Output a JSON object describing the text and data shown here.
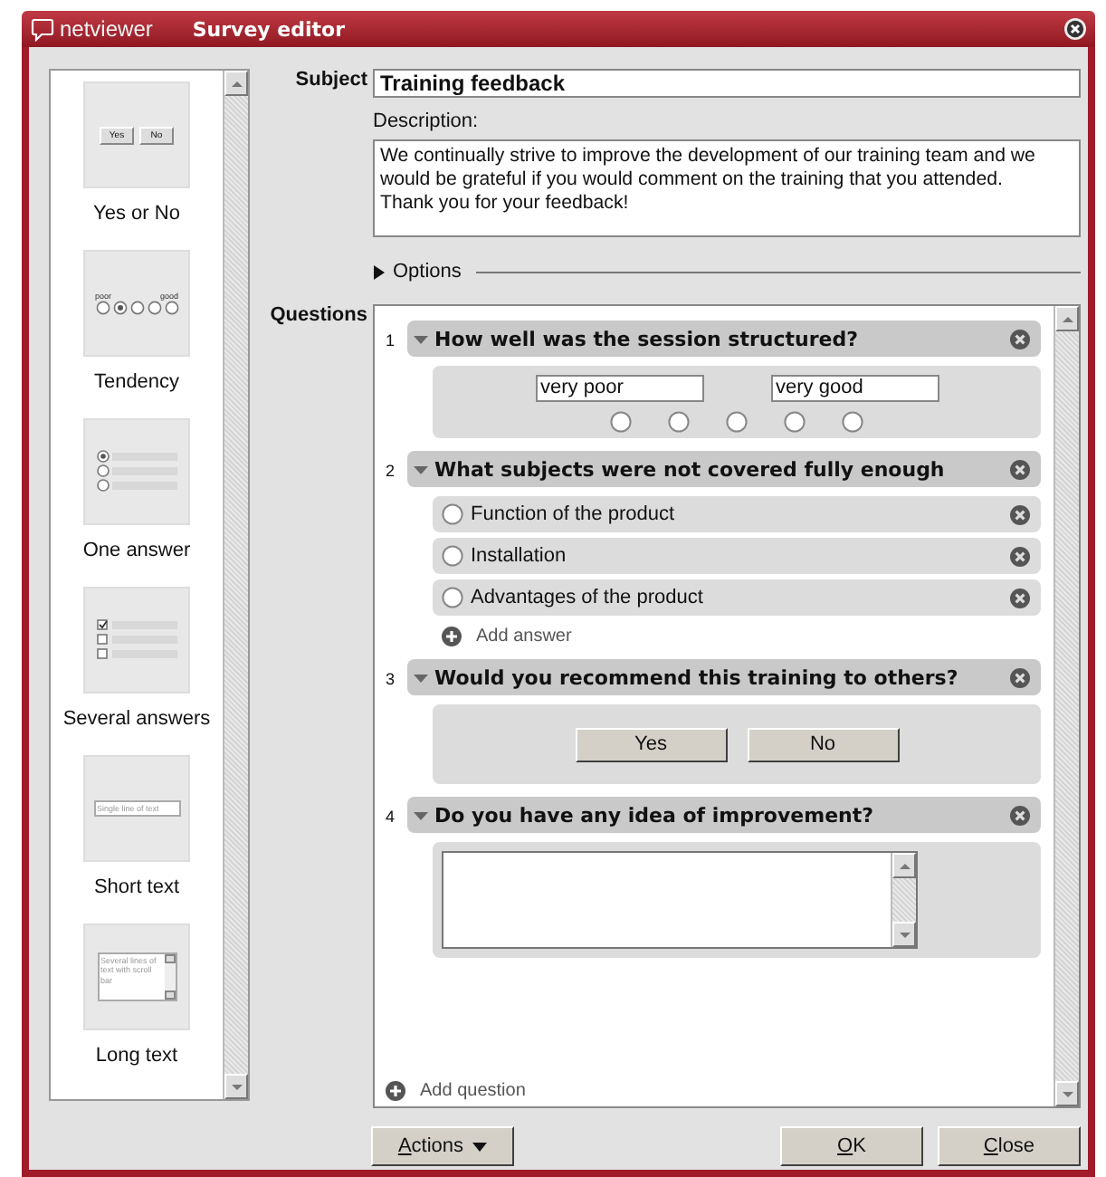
{
  "window": {
    "brand": "netviewer",
    "title": "Survey editor"
  },
  "palette": [
    {
      "kind": "yes_no",
      "label": "Yes or No",
      "sample_texts": [
        "Yes",
        "No"
      ]
    },
    {
      "kind": "tendency",
      "label": "Tendency",
      "sample_texts": [
        "poor",
        "good"
      ]
    },
    {
      "kind": "one_answer",
      "label": "One answer"
    },
    {
      "kind": "several_answers",
      "label": "Several answers"
    },
    {
      "kind": "short_text",
      "label": "Short text",
      "sample_texts": [
        "Single line of text"
      ]
    },
    {
      "kind": "long_text",
      "label": "Long text",
      "sample_texts": [
        "Several lines of text with scroll bar"
      ]
    }
  ],
  "subject": {
    "label": "Subject",
    "value": "Training feedback"
  },
  "description": {
    "label": "Description:",
    "value": "We continually strive to improve the development of our training team and we would be grateful if you would comment on the training that you attended.\nThank you for your feedback!"
  },
  "options": {
    "label": "Options",
    "expanded": false
  },
  "questions": {
    "label": "Questions",
    "items": [
      {
        "number": "1",
        "title": "How well was the session structured?",
        "kind": "tendency",
        "expanded": true,
        "low_label": "very poor",
        "high_label": "very good",
        "options": [
          {
            "selected": false
          },
          {
            "selected": false
          },
          {
            "selected": false
          },
          {
            "selected": false
          },
          {
            "selected": false
          }
        ]
      },
      {
        "number": "2",
        "title": "What subjects were not covered fully enough",
        "kind": "one_answer",
        "expanded": true,
        "answers": [
          {
            "text": "Function of the product",
            "selected": false
          },
          {
            "text": "Installation",
            "selected": false
          },
          {
            "text": "Advantages of the product",
            "selected": false
          }
        ],
        "add_answer": "Add answer"
      },
      {
        "number": "3",
        "title": "Would you recommend this training to others?",
        "kind": "yes_no",
        "expanded": true,
        "buttons": [
          "Yes",
          "No"
        ]
      },
      {
        "number": "4",
        "title": "Do you have any idea of improvement?",
        "kind": "long_text",
        "expanded": true
      }
    ],
    "add_question": "Add question"
  },
  "buttons": {
    "actions": "Actions",
    "ok": "OK",
    "close": "Close"
  }
}
